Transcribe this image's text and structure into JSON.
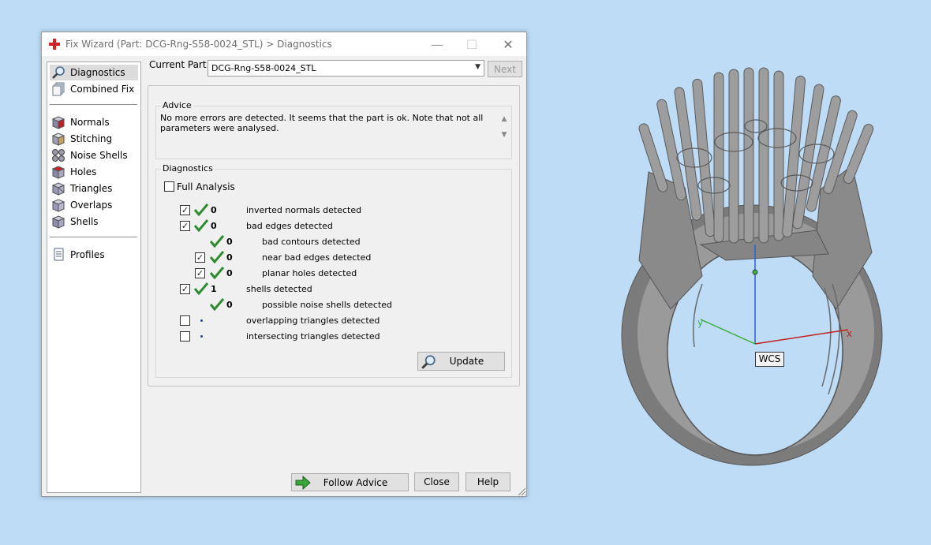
{
  "window": {
    "title": "Fix Wizard (Part: DCG-Rng-S58-0024_STL) > Diagnostics",
    "min_glyph": "—",
    "max_glyph": "☐",
    "close_glyph": "✕"
  },
  "nav": {
    "items": [
      {
        "label": "Diagnostics",
        "icon": "magnifier-icon",
        "selected": true
      },
      {
        "label": "Combined Fix",
        "icon": "stacked-pages-icon"
      },
      {
        "label": "Normals",
        "icon": "normals-cube-icon"
      },
      {
        "label": "Stitching",
        "icon": "stitching-icon"
      },
      {
        "label": "Noise Shells",
        "icon": "noise-shells-icon"
      },
      {
        "label": "Holes",
        "icon": "holes-cube-icon"
      },
      {
        "label": "Triangles",
        "icon": "triangles-cube-icon"
      },
      {
        "label": "Overlaps",
        "icon": "overlaps-icon"
      },
      {
        "label": "Shells",
        "icon": "shells-icon"
      },
      {
        "label": "Profiles",
        "icon": "profile-document-icon"
      }
    ]
  },
  "header": {
    "current_part_label": "Current Part:",
    "current_part_value": "DCG-Rng-S58-0024_STL",
    "next_label": "Next"
  },
  "advice": {
    "title": "Advice",
    "line1": "No more errors are detected. It seems that the part is ok. Note that not all",
    "line2": "parameters were analysed."
  },
  "diagnostics": {
    "title": "Diagnostics",
    "full_analysis_label": "Full Analysis",
    "full_analysis_checked": false,
    "rows": [
      {
        "checkbox": true,
        "checked": true,
        "status": "ok",
        "count": "0",
        "label": "inverted normals detected",
        "indent": 0
      },
      {
        "checkbox": true,
        "checked": true,
        "status": "ok",
        "count": "0",
        "label": "bad edges detected",
        "indent": 0
      },
      {
        "checkbox": false,
        "checked": false,
        "status": "ok",
        "count": "0",
        "label": "bad contours detected",
        "indent": 1
      },
      {
        "checkbox": true,
        "checked": true,
        "status": "ok",
        "count": "0",
        "label": "near bad edges detected",
        "indent": 1
      },
      {
        "checkbox": true,
        "checked": true,
        "status": "ok",
        "count": "0",
        "label": "planar holes detected",
        "indent": 1
      },
      {
        "checkbox": true,
        "checked": true,
        "status": "ok",
        "count": "1",
        "label": "shells detected",
        "indent": 0
      },
      {
        "checkbox": false,
        "checked": false,
        "status": "ok",
        "count": "0",
        "label": "possible noise shells detected",
        "indent": 1
      },
      {
        "checkbox": true,
        "checked": false,
        "status": "none",
        "count": "",
        "label": "overlapping triangles detected",
        "indent": 0
      },
      {
        "checkbox": true,
        "checked": false,
        "status": "none",
        "count": "",
        "label": "intersecting triangles detected",
        "indent": 0
      }
    ],
    "update_label": "Update"
  },
  "footer": {
    "follow_advice_label": "Follow Advice",
    "close_label": "Close",
    "help_label": "Help"
  },
  "viewport": {
    "wcs_label": "WCS",
    "axis_x": "x",
    "axis_y": "y"
  },
  "colors": {
    "check_green": "#2e8b2e",
    "model_gray": "#8e8e8e",
    "background": "#bedcf6"
  }
}
